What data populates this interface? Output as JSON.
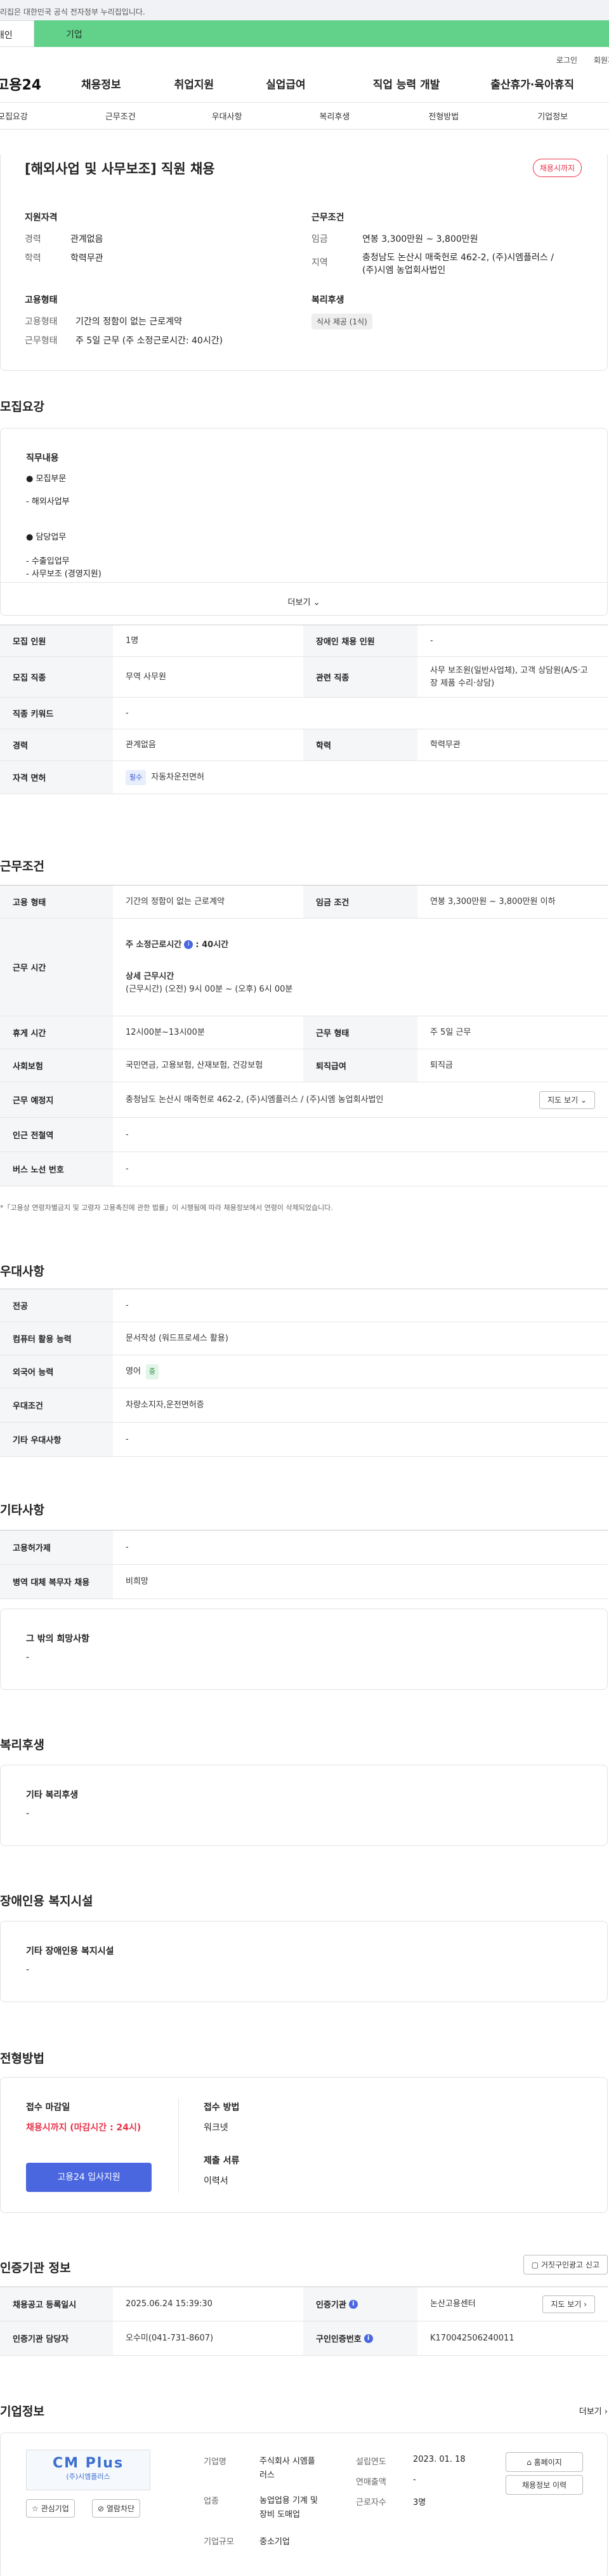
{
  "topbar": {
    "text": "이 누리집은 대한민국 공식 전자정부 누리집입니다."
  },
  "tabs": {
    "t1": "개인",
    "t2": "기업"
  },
  "util": {
    "login": "로그인",
    "join": "회원가입"
  },
  "gnb": {
    "logo": "고용24",
    "menus": [
      "채용정보",
      "취업지원",
      "실업급여",
      "직업 능력 개발",
      "출산휴가·육아휴직"
    ]
  },
  "subtabs": [
    "모집요강",
    "근무조건",
    "우대사항",
    "복리후생",
    "전형방법",
    "기업정보"
  ],
  "header": {
    "title": "[해외사업 및 사무보조] 직원 채용",
    "status": "채용시까지",
    "qualification": {
      "heading": "지원자격",
      "career_k": "경력",
      "career_v": "관계없음",
      "edu_k": "학력",
      "edu_v": "학력무관"
    },
    "conditions": {
      "heading": "근무조건",
      "wage_k": "임금",
      "wage_v": "연봉 3,300만원 ~ 3,800만원",
      "loc_k": "지역",
      "loc_v1": "충청남도 논산시 매죽헌로 462-2, (주)시엠플러스 /",
      "loc_v2": "(주)시엠 농업회사법인"
    },
    "employment": {
      "heading": "고용형태",
      "type_k": "고용형태",
      "type_v": "기간의 정함이 없는 근로계약",
      "hours_k": "근무형태",
      "hours_v": "주 5일 근무 (주 소정근로시간: 40시간)"
    },
    "welfare": {
      "heading": "복리후생",
      "pill": "식사 제공 (1식)"
    }
  },
  "recruit": {
    "title": "모집요강",
    "desc_heading": "직무내용",
    "b1": "● 모집부문",
    "b1v": "- 해외사업부",
    "b2": "● 담당업무",
    "b2v1": "- 수출입업무",
    "b2v2": "- 사무보조 (경영지원)",
    "more": "더보기",
    "rows": {
      "r1a_k": "모집 인원",
      "r1a_v": "1명",
      "r1b_k": "장애인 채용 인원",
      "r1b_v": "-",
      "r2a_k": "모집 직종",
      "r2a_v": "무역 사무원",
      "r2b_k": "관련 직종",
      "r2b_v": "사무 보조원(일반사업체), 고객 상담원(A/S·고장 제품 수리·상담)",
      "r3_k": "직종 키워드",
      "r3_v": "-",
      "r4a_k": "경력",
      "r4a_v": "관계없음",
      "r4b_k": "학력",
      "r4b_v": "학력무관",
      "r5_k": "자격 면허",
      "r5_tag": "필수",
      "r5_v": "자동차운전면허"
    }
  },
  "work": {
    "title": "근무조건",
    "r1a_k": "고용 형태",
    "r1a_v": "기간의 정함이 없는 근로계약",
    "r1b_k": "임금 조건",
    "r1b_v": "연봉 3,300만원 ~ 3,800만원 이하",
    "r2_k": "근무 시간",
    "r2_l1": "주 소정근로시간",
    "r2_l1b": ": 40시간",
    "r2_l2": "상세 근무시간",
    "r2_l3": "(근무시간) (오전) 9시 00분 ~ (오후) 6시 00분",
    "r3a_k": "휴게 시간",
    "r3a_v": "12시00분~13시00분",
    "r3b_k": "근무 형태",
    "r3b_v": "주 5일 근무",
    "r4a_k": "사회보험",
    "r4a_v": "국민연금, 고용보험, 산재보험, 건강보험",
    "r4b_k": "퇴직급여",
    "r4b_v": "퇴직금",
    "r5_k": "근무 예정지",
    "r5_v": "충청남도 논산시 매죽헌로 462-2, (주)시엠플러스 / (주)시엠 농업회사법인",
    "r5_btn": "지도 보기",
    "r6_k": "인근 전철역",
    "r6_v": "-",
    "r7_k": "버스 노선 번호",
    "r7_v": "-",
    "note": "*「고용상 연령차별금지 및 고령자 고용촉진에 관한 법률」이 시행됨에 따라 채용정보에서 연령이 삭제되었습니다."
  },
  "pref": {
    "title": "우대사항",
    "r1_k": "전공",
    "r1_v": "-",
    "r2_k": "컴퓨터 활용 능력",
    "r2_v": "문서작성 (워드프로세스 활용)",
    "r3_k": "외국어 능력",
    "r3_v": "영어",
    "r3_tag": "중",
    "r4_k": "우대조건",
    "r4_v": "차량소지자,운전면허증",
    "r5_k": "기타 우대사항",
    "r5_v": "-"
  },
  "etc": {
    "title": "기타사항",
    "r1_k": "고용허가제",
    "r1_v": "-",
    "r2_k": "병역 대체 복무자 채용",
    "r2_v": "비희망",
    "box_k": "그 밖의 희망사항",
    "box_v": "-"
  },
  "welfare": {
    "title": "복리후생",
    "box_k": "기타 복리후생",
    "box_v": "-"
  },
  "disabled": {
    "title": "장애인용 복지시설",
    "box_k": "기타 장애인용 복지시설",
    "box_v": "-"
  },
  "process": {
    "title": "전형방법",
    "deadline_k": "접수 마감일",
    "deadline_v": "채용시까지 (마감시간 : 24시)",
    "apply_btn": "고용24 입사지원",
    "method_k": "접수 방법",
    "method_v": "워크넷",
    "docs_k": "제출 서류",
    "docs_v": "이력서"
  },
  "cert": {
    "title": "인증기관 정보",
    "report_btn": "거짓구인광고 신고",
    "r1a_k": "채용공고 등록일시",
    "r1a_v": "2025.06.24 15:39:30",
    "r1b_k": "인증기관",
    "r1b_v": "논산고용센터",
    "r1_btn": "지도 보기",
    "r2a_k": "인증기관 담당자",
    "r2a_v": "오수미(041-731-8607)",
    "r2b_k": "구인인증번호",
    "r2b_v": "K170042506240011"
  },
  "company": {
    "title": "기업정보",
    "more": "더보기",
    "logo_text": "CM Plus",
    "logo_sub": "(주)시엠플러스",
    "interest_btn": "관심기업",
    "block_btn": "열람차단",
    "name_k": "기업명",
    "name_v1": "주식회사 시엠플",
    "name_v2": "러스",
    "industry_k": "업종",
    "industry_v1": "농업업용 기계 및",
    "industry_v2": "장비 도매업",
    "size_k": "기업규모",
    "size_v": "중소기업",
    "founded_k": "설립연도",
    "founded_v": "2023. 01. 18",
    "sales_k": "연매출액",
    "sales_v": "-",
    "staff_k": "근로자수",
    "staff_v": "3명",
    "home_btn": "홈페이지",
    "jobs_btn": "채용정보 이력"
  }
}
